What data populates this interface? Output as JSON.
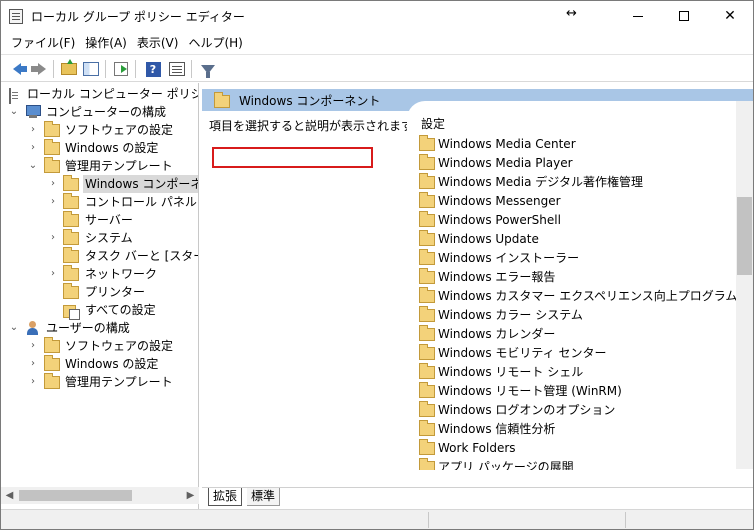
{
  "window": {
    "title": "ローカル グループ ポリシー エディター",
    "resize_glyph": "↔"
  },
  "menu": [
    "ファイル(F)",
    "操作(A)",
    "表示(V)",
    "ヘルプ(H)"
  ],
  "tree": [
    {
      "label": "ローカル コンピューター ポリシー",
      "expander": "",
      "icon": "policy-doc-icon"
    },
    {
      "label": "コンピューターの構成",
      "expander": "⌄",
      "icon": "computer-icon"
    },
    {
      "label": "ソフトウェアの設定",
      "expander": "›",
      "icon": "folder-icon"
    },
    {
      "label": "Windows の設定",
      "expander": "›",
      "icon": "folder-icon"
    },
    {
      "label": "管理用テンプレート",
      "expander": "⌄",
      "icon": "folder-icon"
    },
    {
      "label": "Windows コンポーネント",
      "expander": "›",
      "icon": "folder-icon"
    },
    {
      "label": "コントロール パネル",
      "expander": "›",
      "icon": "folder-icon"
    },
    {
      "label": "サーバー",
      "expander": "",
      "icon": "folder-icon"
    },
    {
      "label": "システム",
      "expander": "›",
      "icon": "folder-icon"
    },
    {
      "label": "タスク バーと [スタート] メ",
      "expander": "",
      "icon": "folder-icon"
    },
    {
      "label": "ネットワーク",
      "expander": "›",
      "icon": "folder-icon"
    },
    {
      "label": "プリンター",
      "expander": "",
      "icon": "folder-icon"
    },
    {
      "label": "すべての設定",
      "expander": "",
      "icon": "all-settings-icon"
    },
    {
      "label": "ユーザーの構成",
      "expander": "⌄",
      "icon": "user-icon"
    },
    {
      "label": "ソフトウェアの設定",
      "expander": "›",
      "icon": "folder-icon"
    },
    {
      "label": "Windows の設定",
      "expander": "›",
      "icon": "folder-icon"
    },
    {
      "label": "管理用テンプレート",
      "expander": "›",
      "icon": "folder-icon"
    }
  ],
  "right": {
    "header_title": "Windows コンポーネント",
    "description": "項目を選択すると説明が表示されます。",
    "column_header": "設定",
    "items": [
      "Windows Media Center",
      "Windows Media Player",
      "Windows Media デジタル著作権管理",
      "Windows Messenger",
      "Windows PowerShell",
      "Windows Update",
      "Windows インストーラー",
      "Windows エラー報告",
      "Windows カスタマー エクスペリエンス向上プログラム",
      "Windows カラー システム",
      "Windows カレンダー",
      "Windows モビリティ センター",
      "Windows リモート シェル",
      "Windows リモート管理 (WinRM)",
      "Windows ログオンのオプション",
      "Windows 信頼性分析",
      "Work Folders",
      "アプリ パッケージの展開"
    ],
    "highlighted_item": "Windows Update"
  },
  "tabs": [
    "拡張",
    "標準"
  ],
  "colors": {
    "header_bar": "#a9c6e6",
    "highlight_border": "#d81b1b",
    "selection": "#d9d9d9"
  }
}
